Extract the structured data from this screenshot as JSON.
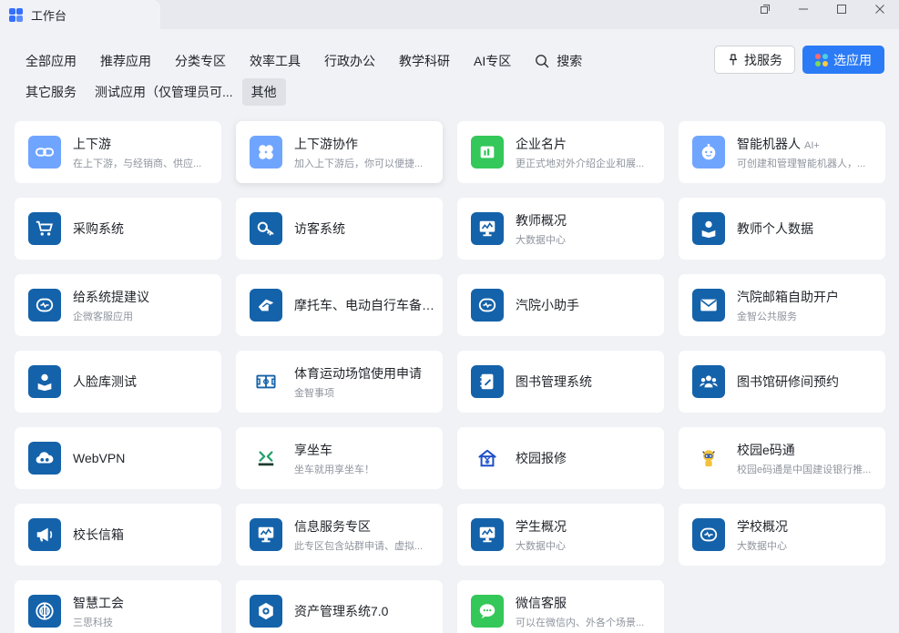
{
  "window": {
    "title": "工作台"
  },
  "nav": {
    "row1": [
      "全部应用",
      "推荐应用",
      "分类专区",
      "效率工具",
      "行政办公",
      "教学科研",
      "AI专区"
    ],
    "search_label": "搜索",
    "row2": [
      "其它服务",
      "测试应用（仅管理员可...",
      "其他"
    ],
    "active": "其他"
  },
  "actions": {
    "find_service": "找服务",
    "choose_app": "选应用"
  },
  "colors": {
    "accent": "#2b7bf6",
    "icon_dark_blue": "#1462aa",
    "icon_light_blue": "#6fa5ff",
    "icon_green": "#34c759"
  },
  "apps": [
    {
      "name": "上下游",
      "desc": "在上下游，与经销商、供应...",
      "icon": "link-icon",
      "color": "#6fa5ff"
    },
    {
      "name": "上下游协作",
      "desc": "加入上下游后，你可以便捷...",
      "icon": "clover-icon",
      "color": "#6fa5ff"
    },
    {
      "name": "企业名片",
      "desc": "更正式地对外介绍企业和展...",
      "icon": "business-card-icon",
      "color": "#34c759"
    },
    {
      "name": "智能机器人",
      "ai": "AI+",
      "desc": "可创建和管理智能机器人，...",
      "icon": "robot-icon",
      "color": "#6fa5ff"
    },
    {
      "name": "采购系统",
      "desc": "",
      "icon": "cart-icon",
      "color": "#1462aa"
    },
    {
      "name": "访客系统",
      "desc": "",
      "icon": "key-icon",
      "color": "#1462aa"
    },
    {
      "name": "教师概况",
      "desc": "大数据中心",
      "icon": "monitor-chart-icon",
      "color": "#1462aa"
    },
    {
      "name": "教师个人数据",
      "desc": "",
      "icon": "person-book-icon",
      "color": "#1462aa"
    },
    {
      "name": "给系统提建议",
      "desc": "企微客服应用",
      "icon": "bot-face-icon",
      "color": "#1462aa"
    },
    {
      "name": "摩托车、电动自行车备案...",
      "desc": "",
      "icon": "motorcycle-icon",
      "color": "#1462aa"
    },
    {
      "name": "汽院小助手",
      "desc": "",
      "icon": "bot-face-icon",
      "color": "#1462aa"
    },
    {
      "name": "汽院邮箱自助开户",
      "desc": "金智公共服务",
      "icon": "mail-icon",
      "color": "#1462aa"
    },
    {
      "name": "人脸库测试",
      "desc": "",
      "icon": "person-book-icon",
      "color": "#1462aa"
    },
    {
      "name": "体育运动场馆使用申请",
      "desc": "金智事项",
      "icon": "field-icon",
      "color": "#ffffff"
    },
    {
      "name": "图书管理系统",
      "desc": "",
      "icon": "notebook-icon",
      "color": "#1462aa"
    },
    {
      "name": "图书馆研修间预约",
      "desc": "",
      "icon": "group-icon",
      "color": "#1462aa"
    },
    {
      "name": "WebVPN",
      "desc": "",
      "icon": "cloud-icon",
      "color": "#1462aa"
    },
    {
      "name": "享坐车",
      "desc": "坐车就用享坐车！",
      "icon": "car-share-logo-icon",
      "color": "#ffffff"
    },
    {
      "name": "校园报修",
      "desc": "",
      "icon": "house-yen-icon",
      "color": "#ffffff"
    },
    {
      "name": "校园e码通",
      "desc": "校园e码通是中国建设银行推...",
      "icon": "mascot-icon",
      "color": "#ffffff"
    },
    {
      "name": "校长信箱",
      "desc": "",
      "icon": "megaphone-icon",
      "color": "#1462aa"
    },
    {
      "name": "信息服务专区",
      "desc": "此专区包含站群申请、虚拟...",
      "icon": "monitor-chart-icon",
      "color": "#1462aa"
    },
    {
      "name": "学生概况",
      "desc": "大数据中心",
      "icon": "monitor-chart-icon",
      "color": "#1462aa"
    },
    {
      "name": "学校概况",
      "desc": "大数据中心",
      "icon": "bot-face-icon",
      "color": "#1462aa"
    },
    {
      "name": "智慧工会",
      "desc": "三思科技",
      "icon": "union-icon",
      "color": "#1462aa"
    },
    {
      "name": "资产管理系统7.0",
      "desc": "",
      "icon": "hexagon-icon",
      "color": "#1462aa"
    },
    {
      "name": "微信客服",
      "desc": "可以在微信内、外各个场景...",
      "icon": "chat-icon",
      "color": "#34c759"
    }
  ]
}
